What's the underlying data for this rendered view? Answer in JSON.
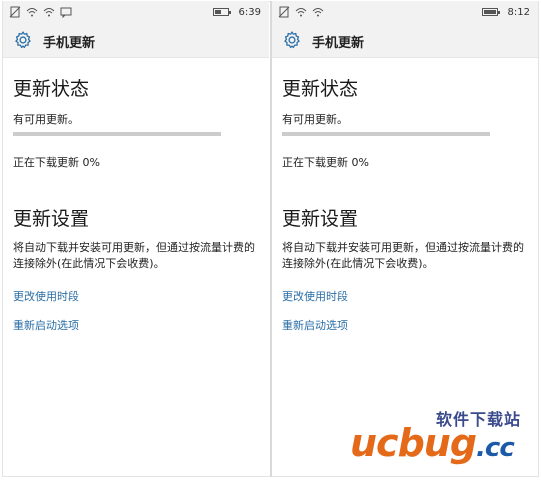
{
  "left_screen": {
    "status": {
      "time": "6:39"
    },
    "app_title": "手机更新",
    "update_status": {
      "heading": "更新状态",
      "message": "有可用更新。",
      "progress_fraction": 0.0,
      "progress_text": "正在下载更新 0%"
    },
    "update_settings": {
      "heading": "更新设置",
      "description": "将自动下载并安装可用更新，但通过按流量计费的连接除外(在此情况下会收费)。",
      "link_change_hours": "更改使用时段",
      "link_restart_options": "重新启动选项"
    }
  },
  "right_screen": {
    "status": {
      "time": "8:12"
    },
    "app_title": "手机更新",
    "update_status": {
      "heading": "更新状态",
      "message": "有可用更新。",
      "progress_fraction": 0.0,
      "progress_text": "正在下载更新 0%"
    },
    "update_settings": {
      "heading": "更新设置",
      "description": "将自动下载并安装可用更新，但通过按流量计费的连接除外(在此情况下会收费)。",
      "link_change_hours": "更改使用时段",
      "link_restart_options": "重新启动选项"
    }
  },
  "watermark": {
    "tagline": "软件下载站",
    "logo_text": "ucbug",
    "logo_suffix": ".cc"
  },
  "colors": {
    "accent": "#0078d7",
    "link": "#2a6ea6",
    "watermark_orange": "#e46a1a",
    "watermark_blue": "#1c5aa8"
  },
  "icons": {
    "app": "gear-icon",
    "status": [
      "no-sim-icon",
      "wifi-icon",
      "wifi-icon",
      "message-icon",
      "battery-icon"
    ]
  }
}
